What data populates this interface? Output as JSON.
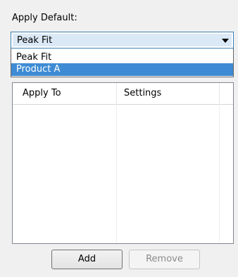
{
  "apply_default": {
    "label": "Apply Default:",
    "selected_value": "Peak Fit",
    "options": [
      "Peak Fit",
      "Product A"
    ],
    "highlighted_option": "Product A"
  },
  "table": {
    "columns": [
      "Apply To",
      "Settings",
      ""
    ],
    "rows": []
  },
  "buttons": {
    "add_label": "Add",
    "remove_label": "Remove"
  },
  "colors": {
    "selection": "#3e8bd4",
    "combo_border": "#3c7fb1",
    "background": "#f0f0f0"
  },
  "icons": {
    "dropdown": "chevron-down-icon"
  }
}
